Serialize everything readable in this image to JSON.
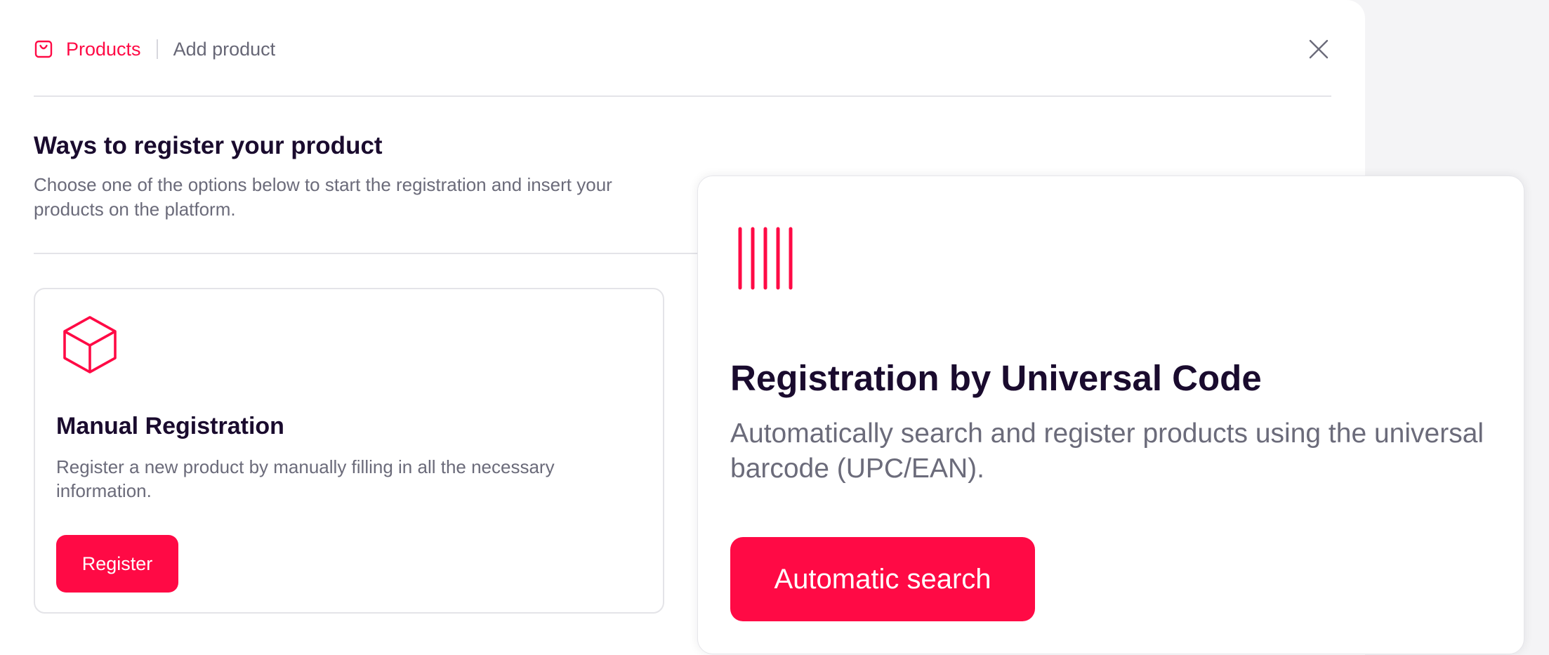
{
  "breadcrumb": {
    "products_label": "Products",
    "current_label": "Add product"
  },
  "icons": {
    "products": "shopping-bag-icon",
    "close": "close-icon",
    "manual": "cube-icon",
    "universal": "barcode-icon"
  },
  "colors": {
    "accent": "#ff0a45",
    "heading": "#1a0b2e",
    "muted_text": "#6b6b7a",
    "border": "#e4e4e8"
  },
  "section": {
    "title": "Ways to register your product",
    "description": "Choose one of the options below to start the registration and insert your products on the platform."
  },
  "manual_card": {
    "title": "Manual Registration",
    "description": "Register a new product by manually filling in all the necessary information.",
    "button_label": "Register"
  },
  "universal_card": {
    "title": "Registration by Universal Code",
    "description": "Automatically search and register products using the universal barcode (UPC/EAN).",
    "button_label": "Automatic search"
  }
}
